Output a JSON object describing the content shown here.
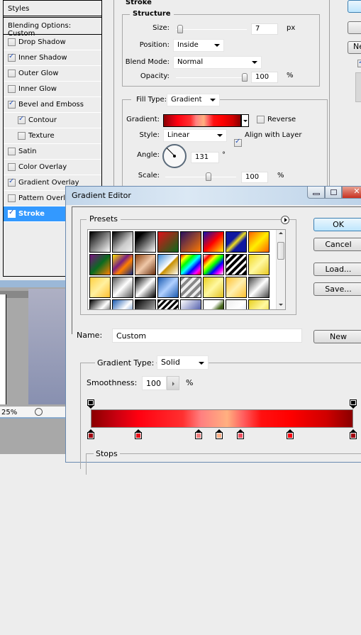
{
  "styles_panel": {
    "header": "Styles",
    "blending": "Blending Options: Custom",
    "items": [
      {
        "label": "Drop Shadow",
        "checked": false,
        "sub": false
      },
      {
        "label": "Inner Shadow",
        "checked": true,
        "sub": false
      },
      {
        "label": "Outer Glow",
        "checked": false,
        "sub": false
      },
      {
        "label": "Inner Glow",
        "checked": false,
        "sub": false
      },
      {
        "label": "Bevel and Emboss",
        "checked": true,
        "sub": false
      },
      {
        "label": "Contour",
        "checked": true,
        "sub": true
      },
      {
        "label": "Texture",
        "checked": false,
        "sub": true
      },
      {
        "label": "Satin",
        "checked": false,
        "sub": false
      },
      {
        "label": "Color Overlay",
        "checked": false,
        "sub": false
      },
      {
        "label": "Gradient Overlay",
        "checked": true,
        "sub": false
      },
      {
        "label": "Pattern Overlay",
        "checked": false,
        "sub": false
      },
      {
        "label": "Stroke",
        "checked": true,
        "sub": false,
        "selected": true
      }
    ]
  },
  "stroke": {
    "title": "Stroke",
    "structure": "Structure",
    "size_label": "Size:",
    "size_value": "7",
    "size_unit": "px",
    "size_fraction": 0.03,
    "position_label": "Position:",
    "position_value": "Inside",
    "blend_label": "Blend Mode:",
    "blend_value": "Normal",
    "opacity_label": "Opacity:",
    "opacity_value": "100",
    "opacity_unit": "%",
    "fill_type_label": "Fill Type:",
    "fill_type_value": "Gradient",
    "gradient_label": "Gradient:",
    "reverse_label": "Reverse",
    "reverse_checked": false,
    "style_label": "Style:",
    "style_value": "Linear",
    "align_label": "Align with Layer",
    "align_checked": true,
    "angle_label": "Angle:",
    "angle_value": "131",
    "angle_unit": "°",
    "scale_label": "Scale:",
    "scale_value": "100",
    "scale_unit": "%"
  },
  "right_buttons": {
    "new_partial": "Ne"
  },
  "document": {
    "zoom": "25%"
  },
  "gradient_editor": {
    "title": "Gradient Editor",
    "presets_label": "Presets",
    "ok": "OK",
    "cancel": "Cancel",
    "load": "Load...",
    "save": "Save...",
    "name_label": "Name:",
    "name_value": "Custom",
    "new": "New",
    "type_label": "Gradient Type:",
    "type_value": "Solid",
    "smoothness_label": "Smoothness:",
    "smoothness_value": "100",
    "smoothness_unit": "%",
    "stops_label": "Stops",
    "presets": [
      "linear-gradient(135deg,#000,#fff)",
      "linear-gradient(135deg,#000,#ccc 60%,#eee)",
      "linear-gradient(135deg,#000 20%,#fff)",
      "linear-gradient(135deg,#e0101a,#0a6a1a)",
      "linear-gradient(135deg,#2a1060,#ff7a00)",
      "linear-gradient(135deg,#1010b0,#ff0000 50%,#ffee00)",
      "linear-gradient(135deg,#1018a0 35%,#f0e020 50%,#1018a0 65%)",
      "linear-gradient(135deg,#ff6000,#ffee00 50%,#ff6000)",
      "linear-gradient(135deg,#7a1080,#0a6a20 50%,#ff8000)",
      "linear-gradient(135deg,#ffe000,#7a2080 40%,#ff8000 60%,#102880)",
      "linear-gradient(135deg,#8a4010,#f0c8a8 50%,#6a3010)",
      "linear-gradient(135deg,#3a8ad8,#fff 50%,#c89000 55%,#fff)",
      "linear-gradient(135deg,#ff0000,#ffff00,#00ff00,#00ffff,#0000ff,#ff00ff,#ff0000)",
      "linear-gradient(135deg,#eee,#ff0000,#ffff00,#00ff00,#0000ff,#ff00ff,#eee)",
      "repeating-linear-gradient(135deg,#000 0 4px,#fff 4px 7px)",
      "linear-gradient(135deg,#f0d820,#fff8a0 50%,#e8c820)",
      "linear-gradient(135deg,#ffd040,#fff0a0 50%,#ffc030)",
      "linear-gradient(135deg,#555,#fff 50%,#555)",
      "linear-gradient(135deg,#000,#fff 50%,#000)",
      "linear-gradient(135deg,#1a5ab0,#b0d0ff 50%,#1a5ab0)",
      "repeating-linear-gradient(135deg,#888 0 4px,#eee 4px 8px)",
      "linear-gradient(135deg,#e8d020,#fff8a0 50%,#e0c020)",
      "linear-gradient(135deg,#ffc030,#fff0b0 50%,#ffc030)",
      "linear-gradient(135deg,#444,#fff 50%,#444)",
      "linear-gradient(135deg,#000,#fff 50%,#000)",
      "linear-gradient(135deg,#1a5ab0,#fff 50%,#1a5ab0)",
      "linear-gradient(135deg,#000,#888 60%,#fff)",
      "repeating-linear-gradient(135deg,#000 0 3px,#fff 3px 6px)",
      "linear-gradient(135deg,#fff,#1a2a90)",
      "linear-gradient(135deg,#fff 40%,#4a6a20 60%,#000)",
      "linear-gradient(135deg,#eee,#fff 50%,#ccd8ff)",
      "linear-gradient(135deg,#e8d020,#fff8a0 50%,#e8d020)"
    ],
    "gradient_css": "linear-gradient(90deg,#8a0000 0%,#cc0010 10%,#ff0010 18%,#ff3030 35%,#ff8080 42%,#ffb080 52%,#ff6060 58%,#ff1010 65%,#ff0000 76%,#d00000 90%,#8a0000 100%)",
    "opacity_stops": [
      {
        "location": 0,
        "color": "#000000"
      },
      {
        "location": 100,
        "color": "#000000"
      }
    ],
    "color_stops": [
      {
        "location": 0,
        "color": "#a00010"
      },
      {
        "location": 18,
        "color": "#e8101a"
      },
      {
        "location": 41,
        "color": "#f08080"
      },
      {
        "location": 49,
        "color": "#ffb088"
      },
      {
        "location": 57,
        "color": "#f05060"
      },
      {
        "location": 76,
        "color": "#ff0010"
      },
      {
        "location": 100,
        "color": "#a00010"
      }
    ]
  }
}
